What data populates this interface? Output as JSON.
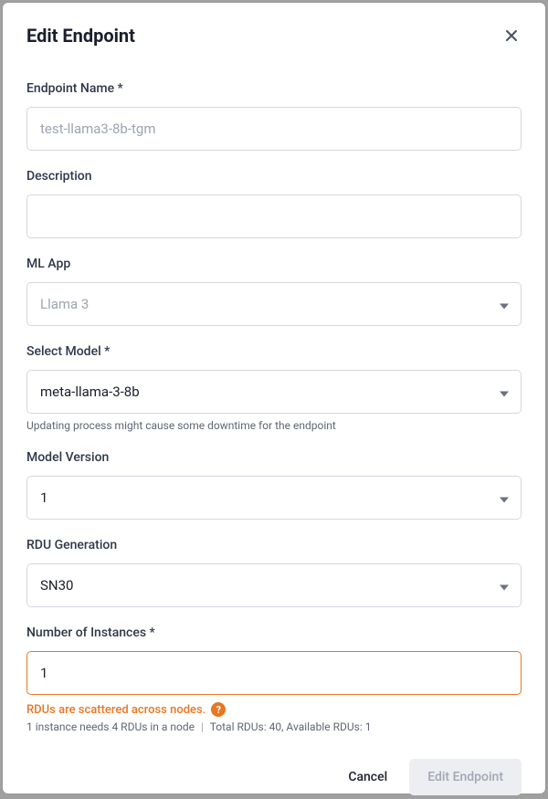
{
  "modal": {
    "title": "Edit Endpoint"
  },
  "fields": {
    "endpoint_name": {
      "label": "Endpoint Name *",
      "placeholder": "test-llama3-8b-tgm",
      "value": ""
    },
    "description": {
      "label": "Description",
      "value": ""
    },
    "ml_app": {
      "label": "ML App",
      "value": "Llama 3"
    },
    "select_model": {
      "label": "Select Model *",
      "value": "meta-llama-3-8b",
      "helper": "Updating process might cause some downtime for the endpoint"
    },
    "model_version": {
      "label": "Model Version",
      "value": "1"
    },
    "rdu_generation": {
      "label": "RDU Generation",
      "value": "SN30"
    },
    "num_instances": {
      "label": "Number of Instances *",
      "value": "1",
      "warning": "RDUs are scattered across nodes.",
      "stats_part1": "1 instance needs 4 RDUs in a node",
      "stats_part2": "Total RDUs: 40, Available RDUs: 1"
    }
  },
  "footer": {
    "cancel": "Cancel",
    "submit": "Edit Endpoint"
  },
  "icons": {
    "help": "?"
  }
}
